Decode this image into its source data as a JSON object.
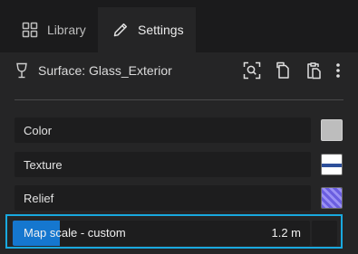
{
  "tabs": [
    {
      "label": "Library",
      "icon": "grid-icon",
      "active": false
    },
    {
      "label": "Settings",
      "icon": "pencil-icon",
      "active": true
    }
  ],
  "header": {
    "title": "Surface: Glass_Exterior",
    "icon": "wine-glass-icon",
    "actions": [
      "search-icon",
      "copy-icon",
      "paste-icon",
      "more-icon"
    ]
  },
  "properties": [
    {
      "label": "Color",
      "swatch": "#bdbdbd"
    },
    {
      "label": "Texture",
      "swatch": "texture-thumbnail"
    },
    {
      "label": "Relief",
      "swatch": "relief-thumbnail"
    }
  ],
  "map_scale": {
    "label": "Map scale - custom",
    "value": "1.2 m",
    "fill_fraction": 0.16
  },
  "colors": {
    "accent": "#1577cf",
    "highlight": "#19a9df",
    "background": "#252526"
  }
}
